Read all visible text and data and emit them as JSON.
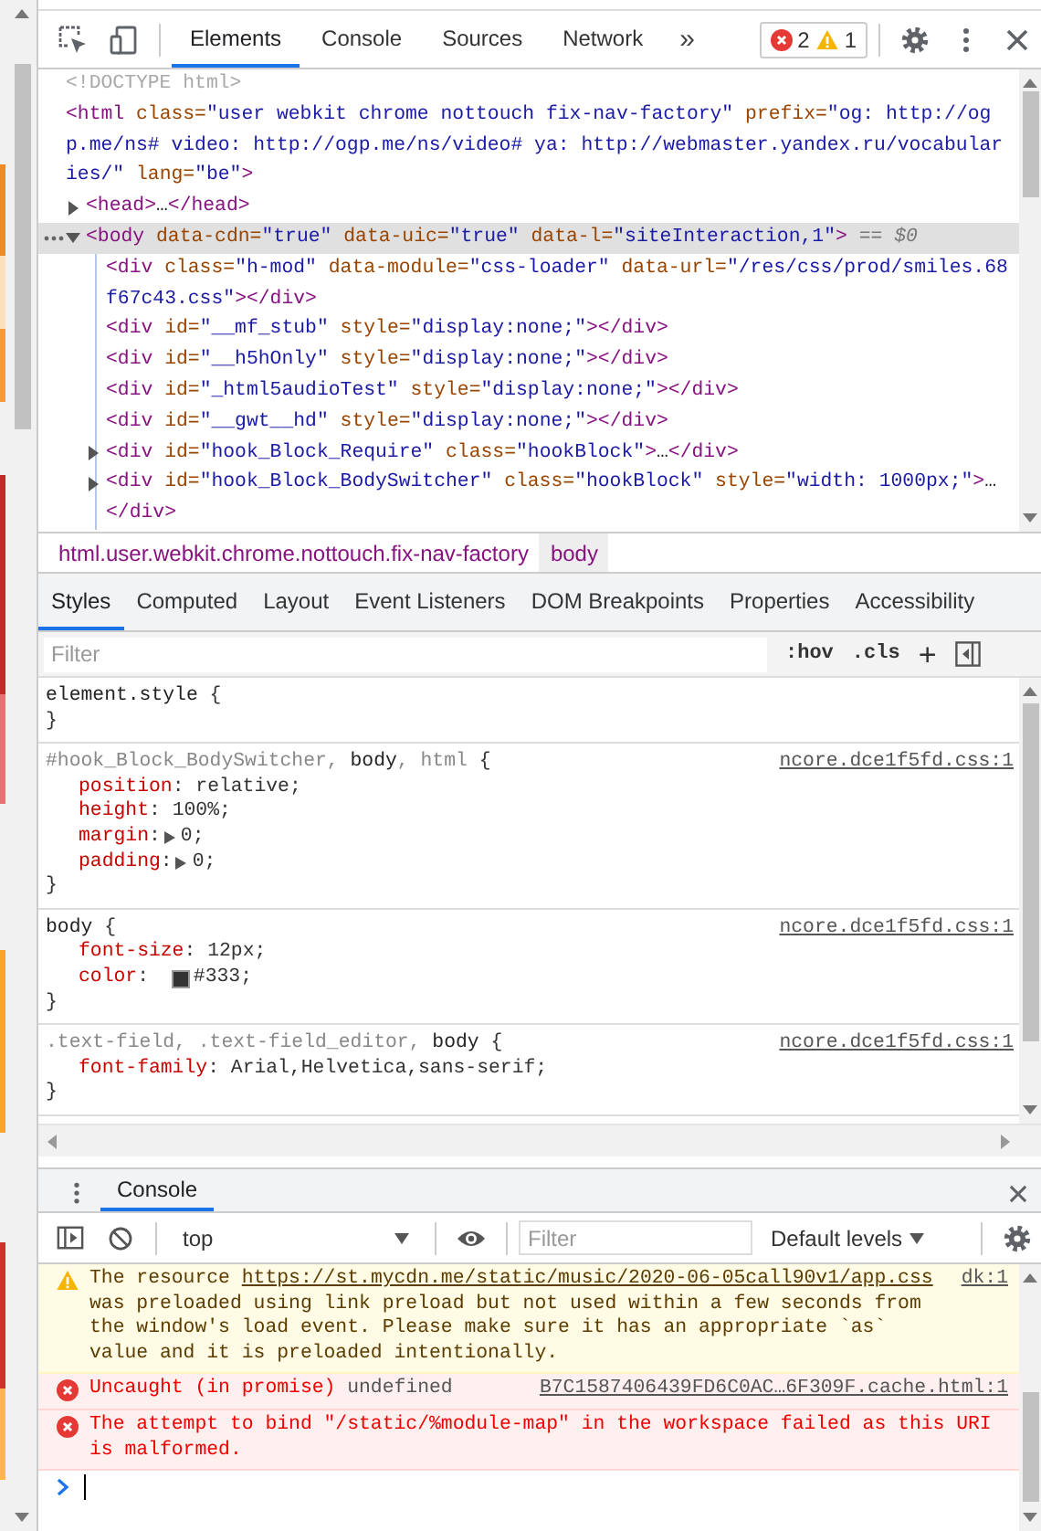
{
  "toolbar": {
    "tabs": [
      {
        "label": "Elements",
        "selected": true
      },
      {
        "label": "Console",
        "selected": false
      },
      {
        "label": "Sources",
        "selected": false
      },
      {
        "label": "Network",
        "selected": false
      }
    ],
    "more": "»",
    "counters": [
      {
        "kind": "error",
        "count": "2"
      },
      {
        "kind": "warning",
        "count": "1"
      }
    ]
  },
  "elements": {
    "nodes": [
      {
        "selected": false,
        "tokens": [
          {
            "kind": "doctype",
            "text": "<!DOCTYPE html>"
          }
        ]
      },
      {
        "selected": false,
        "tokens": [
          {
            "kind": "tag",
            "text": "<html"
          },
          {
            "kind": "attr",
            "text": " class="
          },
          {
            "kind": "value",
            "text": "\"user webkit chrome nottouch fix-nav-factory\""
          },
          {
            "kind": "attr",
            "text": " prefix="
          },
          {
            "kind": "value",
            "text": "\"og: http://ogp.me/ns# video: http://ogp.me/ns/video# ya: http://webmaster.yandex.ru/vocabularies/\""
          },
          {
            "kind": "attr",
            "text": " lang="
          },
          {
            "kind": "value",
            "text": "\"be\""
          },
          {
            "kind": "tag",
            "text": ">"
          }
        ],
        "children": [
          {
            "selected": false,
            "expanded": false,
            "tokens": [
              {
                "kind": "tag",
                "text": "<head>"
              },
              {
                "kind": "text",
                "text": "…"
              },
              {
                "kind": "tag",
                "text": "</head>"
              }
            ]
          },
          {
            "selected": true,
            "expanded": true,
            "marker": "== $0",
            "tokens": [
              {
                "kind": "tag",
                "text": "<body"
              },
              {
                "kind": "attr",
                "text": " data-cdn="
              },
              {
                "kind": "value",
                "text": "\"true\""
              },
              {
                "kind": "attr",
                "text": " data-uic="
              },
              {
                "kind": "value",
                "text": "\"true\""
              },
              {
                "kind": "attr",
                "text": " data-l="
              },
              {
                "kind": "value",
                "text": "\"siteInteraction,1\""
              },
              {
                "kind": "tag",
                "text": ">"
              }
            ],
            "children": [
              {
                "selected": false,
                "tokens": [
                  {
                    "kind": "tag",
                    "text": "<div"
                  },
                  {
                    "kind": "attr",
                    "text": " class="
                  },
                  {
                    "kind": "value",
                    "text": "\"h-mod\""
                  },
                  {
                    "kind": "attr",
                    "text": " data-module="
                  },
                  {
                    "kind": "value",
                    "text": "\"css-loader\""
                  },
                  {
                    "kind": "attr",
                    "text": " data-url="
                  },
                  {
                    "kind": "value",
                    "text": "\"/res/css/prod/smiles.68f67c43.css\""
                  },
                  {
                    "kind": "tag",
                    "text": "></div>"
                  }
                ]
              },
              {
                "selected": false,
                "tokens": [
                  {
                    "kind": "tag",
                    "text": "<div"
                  },
                  {
                    "kind": "attr",
                    "text": " id="
                  },
                  {
                    "kind": "value",
                    "text": "\"__mf_stub\""
                  },
                  {
                    "kind": "attr",
                    "text": " style="
                  },
                  {
                    "kind": "value",
                    "text": "\"display:none;\""
                  },
                  {
                    "kind": "tag",
                    "text": "></div>"
                  }
                ]
              },
              {
                "selected": false,
                "tokens": [
                  {
                    "kind": "tag",
                    "text": "<div"
                  },
                  {
                    "kind": "attr",
                    "text": " id="
                  },
                  {
                    "kind": "value",
                    "text": "\"__h5hOnly\""
                  },
                  {
                    "kind": "attr",
                    "text": " style="
                  },
                  {
                    "kind": "value",
                    "text": "\"display:none;\""
                  },
                  {
                    "kind": "tag",
                    "text": "></div>"
                  }
                ]
              },
              {
                "selected": false,
                "tokens": [
                  {
                    "kind": "tag",
                    "text": "<div"
                  },
                  {
                    "kind": "attr",
                    "text": " id="
                  },
                  {
                    "kind": "value",
                    "text": "\"_html5audioTest\""
                  },
                  {
                    "kind": "attr",
                    "text": " style="
                  },
                  {
                    "kind": "value",
                    "text": "\"display:none;\""
                  },
                  {
                    "kind": "tag",
                    "text": "></div>"
                  }
                ]
              },
              {
                "selected": false,
                "tokens": [
                  {
                    "kind": "tag",
                    "text": "<div"
                  },
                  {
                    "kind": "attr",
                    "text": " id="
                  },
                  {
                    "kind": "value",
                    "text": "\"__gwt__hd\""
                  },
                  {
                    "kind": "attr",
                    "text": " style="
                  },
                  {
                    "kind": "value",
                    "text": "\"display:none;\""
                  },
                  {
                    "kind": "tag",
                    "text": "></div>"
                  }
                ]
              },
              {
                "selected": false,
                "expanded": false,
                "tokens": [
                  {
                    "kind": "tag",
                    "text": "<div"
                  },
                  {
                    "kind": "attr",
                    "text": " id="
                  },
                  {
                    "kind": "value",
                    "text": "\"hook_Block_Require\""
                  },
                  {
                    "kind": "attr",
                    "text": " class="
                  },
                  {
                    "kind": "value",
                    "text": "\"hookBlock\""
                  },
                  {
                    "kind": "tag",
                    "text": ">"
                  },
                  {
                    "kind": "text",
                    "text": "…"
                  },
                  {
                    "kind": "tag",
                    "text": "</div>"
                  }
                ]
              },
              {
                "selected": false,
                "expanded": false,
                "tokens": [
                  {
                    "kind": "tag",
                    "text": "<div"
                  },
                  {
                    "kind": "attr",
                    "text": " id="
                  },
                  {
                    "kind": "value",
                    "text": "\"hook_Block_BodySwitcher\""
                  },
                  {
                    "kind": "attr",
                    "text": " class="
                  },
                  {
                    "kind": "value",
                    "text": "\"hookBlock\""
                  },
                  {
                    "kind": "attr",
                    "text": " style="
                  },
                  {
                    "kind": "value",
                    "text": "\"width: 1000px;\""
                  },
                  {
                    "kind": "tag",
                    "text": ">"
                  },
                  {
                    "kind": "text",
                    "text": "…"
                  },
                  {
                    "kind": "tag",
                    "text": "</div>"
                  }
                ]
              }
            ]
          }
        ]
      }
    ]
  },
  "breadcrumbs": [
    {
      "label": "html.user.webkit.chrome.nottouch.fix-nav-factory",
      "selected": false
    },
    {
      "label": "body",
      "selected": true
    }
  ],
  "styles": {
    "tabs": [
      {
        "label": "Styles",
        "selected": true
      },
      {
        "label": "Computed",
        "selected": false
      },
      {
        "label": "Layout",
        "selected": false
      },
      {
        "label": "Event Listeners",
        "selected": false
      },
      {
        "label": "DOM Breakpoints",
        "selected": false
      },
      {
        "label": "Properties",
        "selected": false
      },
      {
        "label": "Accessibility",
        "selected": false
      }
    ],
    "filter": {
      "placeholder": "Filter"
    },
    "hov": ":hov",
    "cls": ".cls",
    "plus": "+",
    "rules": [
      {
        "selector": [
          {
            "text": "element.style",
            "matched": true
          }
        ],
        "open": " {",
        "close": "}"
      },
      {
        "selector": [
          {
            "text": "#hook_Block_BodySwitcher, ",
            "matched": false
          },
          {
            "text": "body",
            "matched": true
          },
          {
            "text": ", html",
            "matched": false
          }
        ],
        "open": " {",
        "close": "}",
        "source": "ncore.dce1f5fd.css:1",
        "declarations": [
          {
            "property": "position",
            "colon": ":",
            "value": "relative;",
            "expandable": false
          },
          {
            "property": "height",
            "colon": ":",
            "value": "100%;",
            "expandable": false
          },
          {
            "property": "margin",
            "colon": ":",
            "value": "0;",
            "expandable": true
          },
          {
            "property": "padding",
            "colon": ":",
            "value": "0;",
            "expandable": true
          }
        ]
      },
      {
        "selector": [
          {
            "text": "body",
            "matched": true
          }
        ],
        "open": " {",
        "close": "}",
        "source": "ncore.dce1f5fd.css:1",
        "declarations": [
          {
            "property": "font-size",
            "colon": ":",
            "value": "12px;",
            "expandable": false,
            "kind": "plain"
          },
          {
            "property": "color",
            "colon": ":",
            "value": "#333;",
            "expandable": false,
            "kind": "color"
          }
        ]
      },
      {
        "selector": [
          {
            "text": ".text-field, .text-field_editor, ",
            "matched": false
          },
          {
            "text": "body",
            "matched": true
          }
        ],
        "open": " {",
        "close": "}",
        "source": "ncore.dce1f5fd.css:1",
        "declarations": [
          {
            "property": "font-family",
            "colon": ":",
            "value": "Arial,Helvetica,sans-serif;",
            "expandable": false
          }
        ]
      }
    ]
  },
  "drawer": {
    "tabs": [
      {
        "label": "Console",
        "selected": true
      }
    ],
    "context": "top",
    "filter": {
      "placeholder": "Filter"
    },
    "levels": "Default levels",
    "messages": [
      {
        "kind": "warning",
        "parts": [
          {
            "kind": "text",
            "text": "The resource "
          },
          {
            "kind": "link",
            "text": "https://st.mycdn.me/static/music/2020-06-05call90v1/app.css"
          },
          {
            "kind": "text",
            "text": " was preloaded using link preload but not used within a few seconds from the window's load event. Please make sure it has an appropriate `as` value and it is preloaded intentionally."
          }
        ],
        "source": "dk:1"
      },
      {
        "kind": "error",
        "parts": [
          {
            "kind": "text",
            "text": "Uncaught (in promise)"
          },
          {
            "kind": "muted",
            "text": " undefined"
          }
        ],
        "source": "B7C1587406439FD6C0AC…6F309F.cache.html:1"
      },
      {
        "kind": "error",
        "parts": [
          {
            "kind": "text",
            "text": "The attempt to bind \"/static/%module-map\" in the workspace failed as this URI is malformed."
          }
        ]
      }
    ]
  }
}
